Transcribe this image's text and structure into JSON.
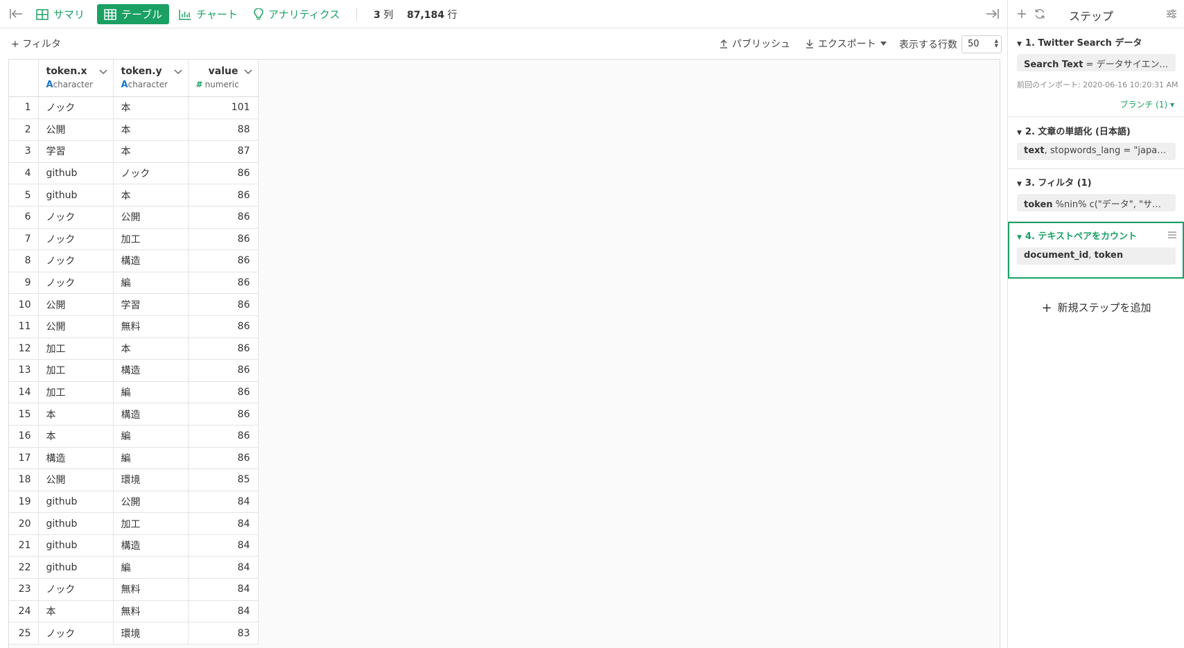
{
  "toolbar": {
    "tabs": [
      {
        "label": "サマリ",
        "icon": "grid-icon"
      },
      {
        "label": "テーブル",
        "icon": "table-icon"
      },
      {
        "label": "チャート",
        "icon": "bar-chart-icon"
      },
      {
        "label": "アナリティクス",
        "icon": "lightbulb-icon"
      }
    ],
    "columns_count": "3",
    "columns_unit": "列",
    "rows_count": "87,184",
    "rows_unit": "行"
  },
  "subbar": {
    "filter": "+ フィルタ",
    "publish": "パブリッシュ",
    "export": "エクスポート",
    "rows_label": "表示する行数",
    "rows_value": "50"
  },
  "table": {
    "columns": [
      {
        "name": "token.x",
        "type_mark": "A",
        "type": "character"
      },
      {
        "name": "token.y",
        "type_mark": "A",
        "type": "character"
      },
      {
        "name": "value",
        "type_mark": "#",
        "type": "numeric"
      }
    ],
    "rows": [
      [
        "1",
        "ノック",
        "本",
        "101"
      ],
      [
        "2",
        "公開",
        "本",
        "88"
      ],
      [
        "3",
        "学習",
        "本",
        "87"
      ],
      [
        "4",
        "github",
        "ノック",
        "86"
      ],
      [
        "5",
        "github",
        "本",
        "86"
      ],
      [
        "6",
        "ノック",
        "公開",
        "86"
      ],
      [
        "7",
        "ノック",
        "加工",
        "86"
      ],
      [
        "8",
        "ノック",
        "構造",
        "86"
      ],
      [
        "9",
        "ノック",
        "編",
        "86"
      ],
      [
        "10",
        "公開",
        "学習",
        "86"
      ],
      [
        "11",
        "公開",
        "無料",
        "86"
      ],
      [
        "12",
        "加工",
        "本",
        "86"
      ],
      [
        "13",
        "加工",
        "構造",
        "86"
      ],
      [
        "14",
        "加工",
        "編",
        "86"
      ],
      [
        "15",
        "本",
        "構造",
        "86"
      ],
      [
        "16",
        "本",
        "編",
        "86"
      ],
      [
        "17",
        "構造",
        "編",
        "86"
      ],
      [
        "18",
        "公開",
        "環境",
        "85"
      ],
      [
        "19",
        "github",
        "公開",
        "84"
      ],
      [
        "20",
        "github",
        "加工",
        "84"
      ],
      [
        "21",
        "github",
        "構造",
        "84"
      ],
      [
        "22",
        "github",
        "編",
        "84"
      ],
      [
        "23",
        "ノック",
        "無料",
        "84"
      ],
      [
        "24",
        "本",
        "無料",
        "84"
      ],
      [
        "25",
        "ノック",
        "環境",
        "83"
      ]
    ]
  },
  "panel": {
    "title": "ステップ",
    "steps": [
      {
        "title": "1. Twitter Search データ",
        "chip_bold": "Search Text",
        "chip_rest": " = データサイエンス, ...",
        "meta": "前回のインポート: 2020-06-16 10:20:31 AM",
        "branch": "ブランチ (1) ▾"
      },
      {
        "title": "2. 文章の単語化 (日本語)",
        "chip_bold": "text",
        "chip_rest": ", stopwords_lang = \"japanese\""
      },
      {
        "title": "3. フィルタ (1)",
        "chip_bold": "token",
        "chip_rest": " %nin% c(\"データ\", \"サイエ..."
      },
      {
        "title": "4. テキストペアをカウント",
        "chip_bold": "document_id",
        "chip_mid": ", ",
        "chip_bold2": "token"
      }
    ],
    "add_step": "新規ステップを追加"
  },
  "colors": {
    "accent": "#1aa063",
    "character_type": "#1c74c9"
  }
}
